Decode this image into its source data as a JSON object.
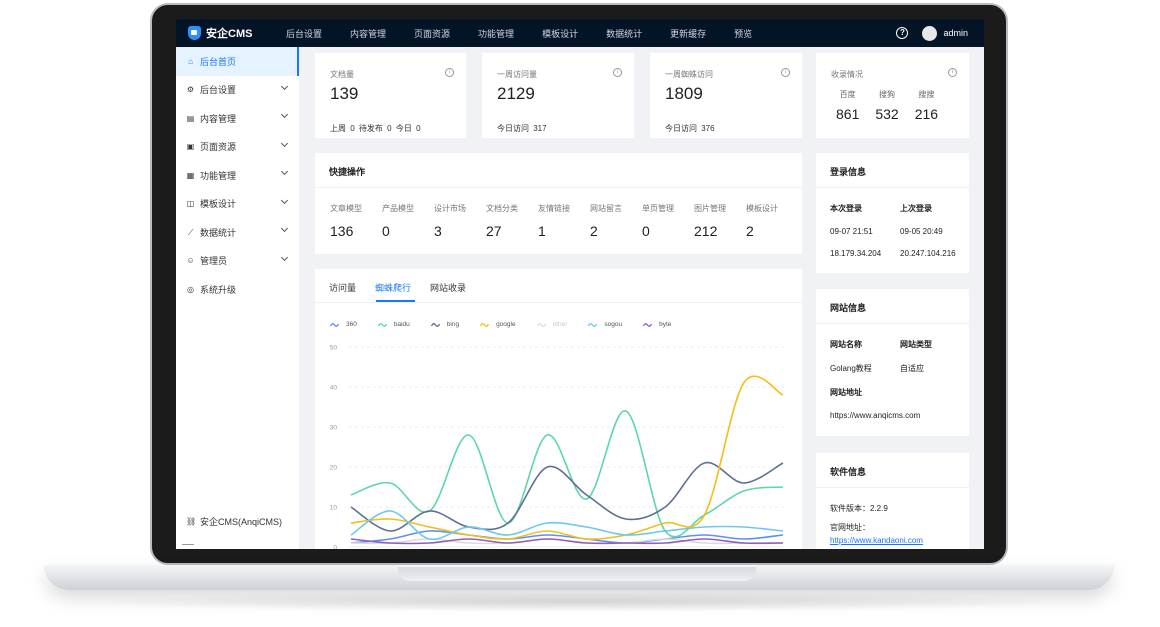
{
  "app": {
    "brand": "安企CMS"
  },
  "topnav": [
    "后台设置",
    "内容管理",
    "页面资源",
    "功能管理",
    "模板设计",
    "数据统计",
    "更新缓存",
    "预览"
  ],
  "user": {
    "name": "admin",
    "help_icon": "question-circle-icon"
  },
  "sidebar": {
    "items": [
      {
        "label": "后台首页",
        "icon": "home-icon",
        "active": true
      },
      {
        "label": "后台设置",
        "icon": "settings-icon"
      },
      {
        "label": "内容管理",
        "icon": "document-icon"
      },
      {
        "label": "页面资源",
        "icon": "page-icon"
      },
      {
        "label": "功能管理",
        "icon": "apps-icon"
      },
      {
        "label": "模板设计",
        "icon": "template-icon"
      },
      {
        "label": "数据统计",
        "icon": "line-chart-icon"
      },
      {
        "label": "管理员",
        "icon": "user-icon"
      },
      {
        "label": "系统升级",
        "icon": "upgrade-icon"
      }
    ],
    "footer": "安企CMS(AnqiCMS)"
  },
  "stats": [
    {
      "label": "文档量",
      "value": "139",
      "foot": [
        "上周",
        "0",
        "待发布",
        "0",
        "今日",
        "0"
      ]
    },
    {
      "label": "一周访问量",
      "value": "2129",
      "foot": [
        "今日访问",
        "317"
      ]
    },
    {
      "label": "一周蜘蛛访问",
      "value": "1809",
      "foot": [
        "今日访问",
        "376"
      ]
    }
  ],
  "records": {
    "label": "收录情况",
    "items": [
      {
        "name": "百度",
        "value": "861"
      },
      {
        "name": "搜狗",
        "value": "532"
      },
      {
        "name": "搜搜",
        "value": "216"
      }
    ]
  },
  "quick": {
    "title": "快捷操作",
    "items": [
      {
        "name": "文章模型",
        "value": "136"
      },
      {
        "name": "产品模型",
        "value": "0"
      },
      {
        "name": "设计市场",
        "value": "3"
      },
      {
        "name": "文档分类",
        "value": "27"
      },
      {
        "name": "友情链接",
        "value": "1"
      },
      {
        "name": "网站留言",
        "value": "2"
      },
      {
        "name": "单页管理",
        "value": "0"
      },
      {
        "name": "图片管理",
        "value": "212"
      },
      {
        "name": "模板设计",
        "value": "2"
      }
    ]
  },
  "chart_tabs": [
    "访问量",
    "蜘蛛爬行",
    "网站收录"
  ],
  "chart_data": {
    "type": "line",
    "y_ticks": [
      "50",
      "40",
      "30",
      "20",
      "10",
      "0"
    ],
    "ylim": [
      0,
      50
    ],
    "series": [
      {
        "name": "360",
        "color": "#5b8ff9",
        "values": [
          1,
          2,
          4,
          3,
          2,
          3,
          2,
          1,
          2,
          3,
          2,
          3
        ]
      },
      {
        "name": "baidu",
        "color": "#5ad8a6",
        "values": [
          13,
          16,
          9,
          28,
          6,
          28,
          12,
          34,
          4,
          8,
          14,
          15
        ]
      },
      {
        "name": "bing",
        "color": "#5d7092",
        "values": [
          10,
          4,
          9,
          5,
          6,
          20,
          13,
          7,
          10,
          21,
          16,
          21
        ]
      },
      {
        "name": "google",
        "color": "#f6bd16",
        "values": [
          6,
          7,
          5,
          3,
          2,
          4,
          2,
          3,
          6,
          8,
          41,
          38
        ]
      },
      {
        "name": "other",
        "color": "#d9dde3",
        "values": [
          1,
          1,
          2,
          1,
          1,
          2,
          1,
          1,
          2,
          1,
          1,
          1
        ]
      },
      {
        "name": "sogou",
        "color": "#6dc8ec",
        "values": [
          3,
          9,
          2,
          5,
          3,
          6,
          5,
          3,
          4,
          5,
          5,
          4
        ]
      },
      {
        "name": "byte",
        "color": "#945fb9",
        "values": [
          2,
          1,
          1,
          2,
          1,
          2,
          1,
          1,
          1,
          2,
          1,
          1
        ]
      }
    ]
  },
  "login": {
    "title": "登录信息",
    "headers": [
      "本次登录",
      "上次登录"
    ],
    "times": [
      "09-07 21:51",
      "09-05 20:49"
    ],
    "ips": [
      "18.179.34.204",
      "20.247.104.216"
    ]
  },
  "site": {
    "title": "网站信息",
    "name_label": "网站名称",
    "type_label": "网站类型",
    "name": "Golang教程",
    "type": "自适应",
    "url_label": "网站地址",
    "url": "https://www.anqicms.com"
  },
  "software": {
    "title": "软件信息",
    "version": "软件版本：2.2.9",
    "official_label": "官网地址：",
    "official_url": "https://www.kandaoni.com"
  }
}
